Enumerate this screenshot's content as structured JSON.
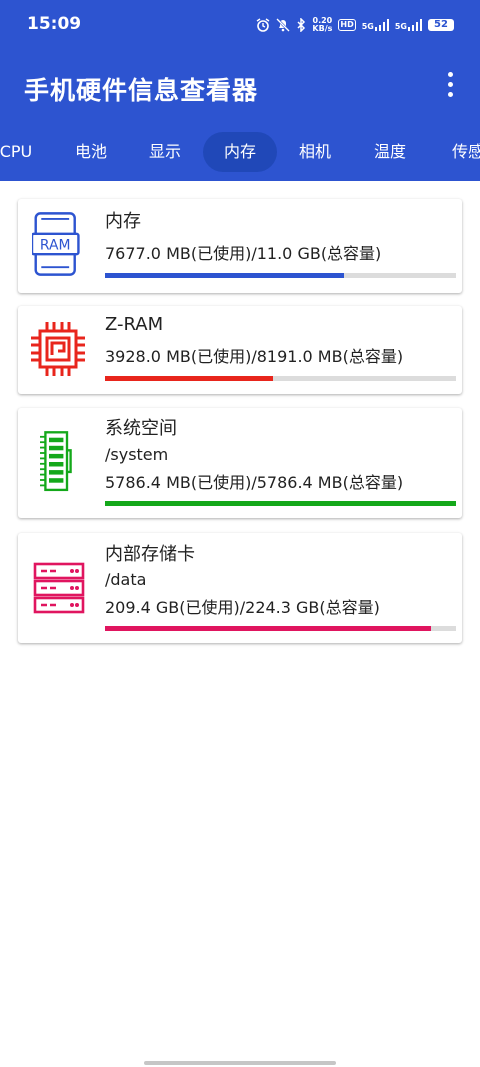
{
  "status": {
    "time": "15:09",
    "net_speed_value": "0.20",
    "net_speed_unit": "KB/s",
    "hd": "HD",
    "sim1": "5G",
    "sim2": "5G",
    "battery": "52"
  },
  "app": {
    "title": "手机硬件信息查看器"
  },
  "tabs": [
    {
      "label": "CPU"
    },
    {
      "label": "电池"
    },
    {
      "label": "显示"
    },
    {
      "label": "内存",
      "active": true
    },
    {
      "label": "相机"
    },
    {
      "label": "温度"
    },
    {
      "label": "传感"
    }
  ],
  "cards": [
    {
      "name": "内存",
      "usage": "7677.0 MB(已使用)/11.0 GB(总容量)",
      "fraction": 0.68,
      "color": "#2d54d0",
      "icon": "ram-icon",
      "icon_text": "RAM"
    },
    {
      "name": "Z-RAM",
      "usage": "3928.0 MB(已使用)/8191.0 MB(总容量)",
      "fraction": 0.48,
      "color": "#e8251c",
      "icon": "chip-icon"
    },
    {
      "name": "系统空间",
      "path": "/system",
      "usage": "5786.4 MB(已使用)/5786.4 MB(总容量)",
      "fraction": 1.0,
      "color": "#14a81a",
      "icon": "memory-stick-icon"
    },
    {
      "name": "内部存储卡",
      "path": "/data",
      "usage": "209.4 GB(已使用)/224.3 GB(总容量)",
      "fraction": 0.93,
      "color": "#e0155f",
      "icon": "server-storage-icon"
    }
  ]
}
